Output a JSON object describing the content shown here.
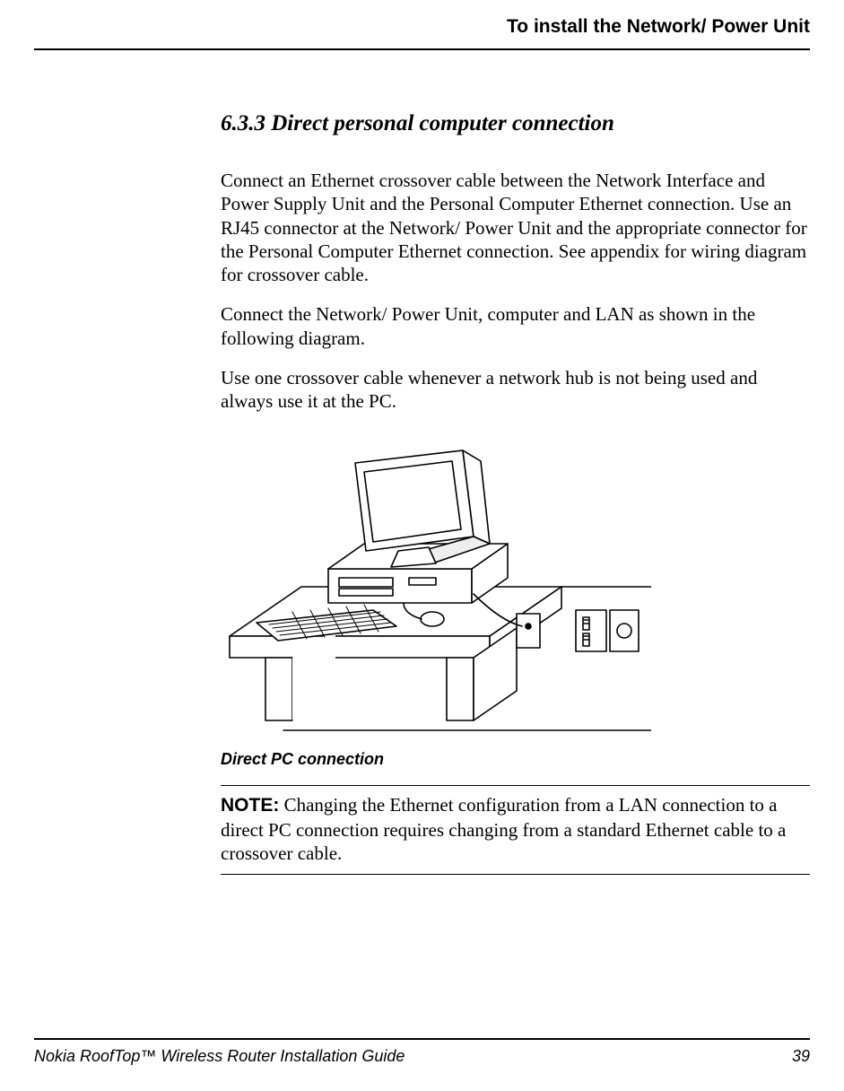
{
  "header": {
    "title": "To install the Network/ Power Unit"
  },
  "section": {
    "number": "6.3.3",
    "title": "Direct personal computer connection"
  },
  "paragraphs": {
    "p1": "Connect an Ethernet crossover cable between the Network Interface and Power Supply Unit and the Personal Computer Ethernet connection. Use an RJ45 connector at the Network/ Power Unit and the appropriate connector for the Personal Computer Ethernet connection. See appendix for wiring diagram for crossover cable.",
    "p2": "Connect the Network/ Power Unit, computer and LAN as shown in the following diagram.",
    "p3": "Use one crossover cable whenever a network hub is not being used and always use it at the PC."
  },
  "figure": {
    "caption": "Direct PC connection"
  },
  "note": {
    "label": "NOTE:",
    "text": " Changing the Ethernet configuration from a LAN connection to a direct PC connection requires changing from a standard Ethernet cable to a crossover cable."
  },
  "footer": {
    "left": "Nokia RoofTop™ Wireless Router Installation Guide",
    "right": "39"
  }
}
